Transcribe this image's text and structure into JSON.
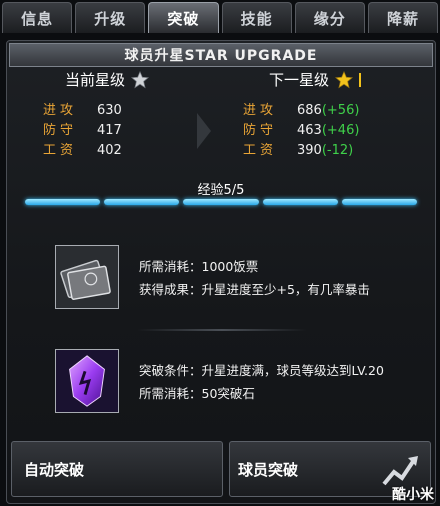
{
  "tabs": [
    "信息",
    "升级",
    "突破",
    "技能",
    "缘分",
    "降薪"
  ],
  "active_tab": "突破",
  "panel": {
    "title": "球员升星STAR UPGRADE",
    "current_star_label": "当前星级",
    "next_star_label": "下一星级"
  },
  "current_stats": [
    {
      "label": "进攻",
      "value": "630"
    },
    {
      "label": "防守",
      "value": "417"
    },
    {
      "label": "工资",
      "value": "402"
    }
  ],
  "next_stats": [
    {
      "label": "进攻",
      "value": "686",
      "delta": "(+56)"
    },
    {
      "label": "防守",
      "value": "463",
      "delta": "(+46)"
    },
    {
      "label": "工资",
      "value": "390",
      "delta": "(-12)"
    }
  ],
  "experience": {
    "label": "经验5/5",
    "filled_segments": 5,
    "total_segments": 5
  },
  "cost": {
    "line1": "所需消耗：1000饭票",
    "line2": "获得成果：升星进度至少+5，有几率暴击"
  },
  "breakthrough": {
    "line1": "突破条件：升星进度满，球员等级达到LV.20",
    "line2": "所需消耗：50突破石"
  },
  "buttons": {
    "auto": "自动突破",
    "player": "球员突破"
  },
  "watermark": "酷小米",
  "colors": {
    "accent_orange": "#e8a436",
    "positive_green": "#3fd14a",
    "exp_blue": "#2aa8e8"
  }
}
